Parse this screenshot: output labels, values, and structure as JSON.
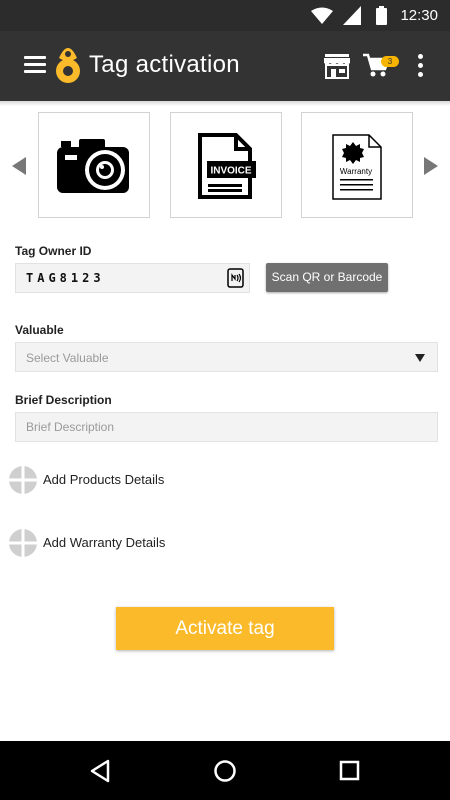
{
  "status_bar": {
    "time": "12:30",
    "icons": [
      "wifi-icon",
      "signal-icon",
      "battery-icon"
    ]
  },
  "app_bar": {
    "title": "Tag activation",
    "cart_count": "3",
    "icons": [
      "menu-icon",
      "logo-icon",
      "store-icon",
      "cart-icon",
      "more-icon"
    ]
  },
  "carousel": {
    "items": [
      {
        "name": "camera-icon"
      },
      {
        "name": "invoice-icon",
        "text": "INVOICE"
      },
      {
        "name": "warranty-icon",
        "text": "Warranty"
      }
    ]
  },
  "form": {
    "tag_owner_label": "Tag Owner ID",
    "tag_owner_value": "TAG8123",
    "scan_button": "Scan QR or Barcode",
    "valuable_label": "Valuable",
    "valuable_placeholder": "Select Valuable",
    "description_label": "Brief Description",
    "description_placeholder": "Brief Description",
    "add_products": "Add Products Details",
    "add_warranty": "Add Warranty Details",
    "activate_button": "Activate tag"
  },
  "colors": {
    "accent": "#fbba2a",
    "app_bar": "#333333",
    "status_bar": "#2c2c2c",
    "scan_button": "#707070"
  }
}
